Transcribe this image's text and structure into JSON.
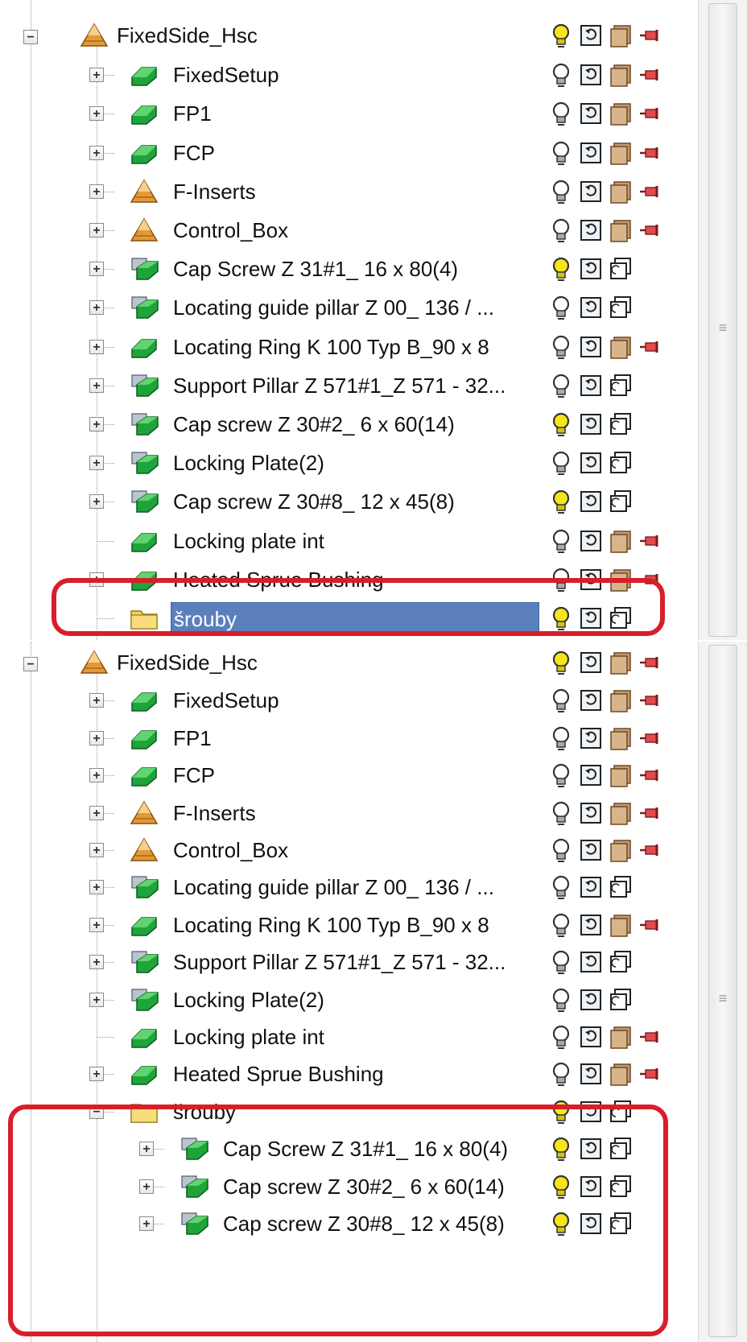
{
  "panels": [
    {
      "id": "before",
      "root": {
        "label": "FixedSide_Hsc",
        "icon": "assembly-icon",
        "expanded": true,
        "bulb": "on"
      },
      "items": [
        {
          "label": "FixedSetup",
          "icon": "part-icon",
          "expander": "+",
          "bulb": "off",
          "controls": [
            "bulb-icon",
            "reset-icon",
            "material-icon",
            "pin-icon"
          ]
        },
        {
          "label": "FP1",
          "icon": "part-icon",
          "expander": "+",
          "bulb": "off",
          "controls": [
            "bulb-icon",
            "reset-icon",
            "material-icon",
            "pin-icon"
          ]
        },
        {
          "label": "FCP",
          "icon": "part-icon",
          "expander": "+",
          "bulb": "off",
          "controls": [
            "bulb-icon",
            "reset-icon",
            "material-icon",
            "pin-icon"
          ]
        },
        {
          "label": "F-Inserts",
          "icon": "assembly-icon",
          "expander": "+",
          "bulb": "off",
          "controls": [
            "bulb-icon",
            "reset-icon",
            "material-icon",
            "pin-icon"
          ]
        },
        {
          "label": "Control_Box",
          "icon": "assembly-icon",
          "expander": "+",
          "bulb": "off",
          "controls": [
            "bulb-icon",
            "reset-icon",
            "material-icon",
            "pin-icon"
          ]
        },
        {
          "label": "Cap Screw Z 31#1_ 16 x 80(4)",
          "icon": "component-icon",
          "expander": "+",
          "bulb": "on",
          "controls": [
            "bulb-icon",
            "reset-icon",
            "view-icon"
          ]
        },
        {
          "label": "Locating guide pillar Z 00_ 136 / ...",
          "icon": "component-icon",
          "expander": "+",
          "bulb": "off",
          "controls": [
            "bulb-icon",
            "reset-icon",
            "view-icon"
          ]
        },
        {
          "label": "Locating Ring K 100 Typ B_90 x 8",
          "icon": "part-icon",
          "expander": "+",
          "bulb": "off",
          "controls": [
            "bulb-icon",
            "reset-icon",
            "material-icon",
            "pin-icon"
          ]
        },
        {
          "label": "Support Pillar Z 571#1_Z 571 - 32...",
          "icon": "component-icon",
          "expander": "+",
          "bulb": "off",
          "controls": [
            "bulb-icon",
            "reset-icon",
            "view-icon"
          ]
        },
        {
          "label": "Cap screw Z 30#2_ 6 x 60(14)",
          "icon": "component-icon",
          "expander": "+",
          "bulb": "on",
          "controls": [
            "bulb-icon",
            "reset-icon",
            "view-icon"
          ]
        },
        {
          "label": "Locking Plate(2)",
          "icon": "component-icon",
          "expander": "+",
          "bulb": "off",
          "controls": [
            "bulb-icon",
            "reset-icon",
            "view-icon"
          ]
        },
        {
          "label": "Cap screw Z 30#8_ 12 x 45(8)",
          "icon": "component-icon",
          "expander": "+",
          "bulb": "on",
          "controls": [
            "bulb-icon",
            "reset-icon",
            "view-icon"
          ]
        },
        {
          "label": "Locking plate int",
          "icon": "part-icon",
          "expander": "",
          "bulb": "off",
          "controls": [
            "bulb-icon",
            "reset-icon",
            "material-icon",
            "pin-icon"
          ]
        },
        {
          "label": "Heated Sprue Bushing",
          "icon": "part-icon",
          "expander": "+",
          "bulb": "off",
          "controls": [
            "bulb-icon",
            "reset-icon",
            "material-icon",
            "pin-icon"
          ]
        },
        {
          "label": "šrouby",
          "icon": "folder-icon",
          "expander": "",
          "bulb": "on",
          "selected": true,
          "controls": [
            "bulb-icon",
            "reset-icon",
            "view-icon"
          ]
        }
      ]
    },
    {
      "id": "after",
      "root": {
        "label": "FixedSide_Hsc",
        "icon": "assembly-icon",
        "expanded": true,
        "bulb": "on"
      },
      "items": [
        {
          "label": "FixedSetup",
          "icon": "part-icon",
          "expander": "+",
          "bulb": "off",
          "controls": [
            "bulb-icon",
            "reset-icon",
            "material-icon",
            "pin-icon"
          ]
        },
        {
          "label": "FP1",
          "icon": "part-icon",
          "expander": "+",
          "bulb": "off",
          "controls": [
            "bulb-icon",
            "reset-icon",
            "material-icon",
            "pin-icon"
          ]
        },
        {
          "label": "FCP",
          "icon": "part-icon",
          "expander": "+",
          "bulb": "off",
          "controls": [
            "bulb-icon",
            "reset-icon",
            "material-icon",
            "pin-icon"
          ]
        },
        {
          "label": "F-Inserts",
          "icon": "assembly-icon",
          "expander": "+",
          "bulb": "off",
          "controls": [
            "bulb-icon",
            "reset-icon",
            "material-icon",
            "pin-icon"
          ]
        },
        {
          "label": "Control_Box",
          "icon": "assembly-icon",
          "expander": "+",
          "bulb": "off",
          "controls": [
            "bulb-icon",
            "reset-icon",
            "material-icon",
            "pin-icon"
          ]
        },
        {
          "label": "Locating guide pillar Z 00_ 136 / ...",
          "icon": "component-icon",
          "expander": "+",
          "bulb": "off",
          "controls": [
            "bulb-icon",
            "reset-icon",
            "view-icon"
          ]
        },
        {
          "label": "Locating Ring K 100 Typ B_90 x 8",
          "icon": "part-icon",
          "expander": "+",
          "bulb": "off",
          "controls": [
            "bulb-icon",
            "reset-icon",
            "material-icon",
            "pin-icon"
          ]
        },
        {
          "label": "Support Pillar Z 571#1_Z 571 - 32...",
          "icon": "component-icon",
          "expander": "+",
          "bulb": "off",
          "controls": [
            "bulb-icon",
            "reset-icon",
            "view-icon"
          ]
        },
        {
          "label": "Locking Plate(2)",
          "icon": "component-icon",
          "expander": "+",
          "bulb": "off",
          "controls": [
            "bulb-icon",
            "reset-icon",
            "view-icon"
          ]
        },
        {
          "label": "Locking plate int",
          "icon": "part-icon",
          "expander": "",
          "bulb": "off",
          "controls": [
            "bulb-icon",
            "reset-icon",
            "material-icon",
            "pin-icon"
          ]
        },
        {
          "label": "Heated Sprue Bushing",
          "icon": "part-icon",
          "expander": "+",
          "bulb": "off",
          "controls": [
            "bulb-icon",
            "reset-icon",
            "material-icon",
            "pin-icon"
          ]
        },
        {
          "label": "šrouby",
          "icon": "folder-icon",
          "expander": "−",
          "bulb": "on",
          "controls": [
            "bulb-icon",
            "reset-icon",
            "view-icon"
          ]
        },
        {
          "label": "Cap Screw Z 31#1_ 16 x 80(4)",
          "icon": "component-icon",
          "expander": "+",
          "bulb": "on",
          "child": true,
          "controls": [
            "bulb-icon",
            "reset-icon",
            "view-icon"
          ]
        },
        {
          "label": "Cap screw Z 30#2_ 6 x 60(14)",
          "icon": "component-icon",
          "expander": "+",
          "bulb": "on",
          "child": true,
          "controls": [
            "bulb-icon",
            "reset-icon",
            "view-icon"
          ]
        },
        {
          "label": "Cap screw Z 30#8_ 12 x 45(8)",
          "icon": "component-icon",
          "expander": "+",
          "bulb": "on",
          "child": true,
          "controls": [
            "bulb-icon",
            "reset-icon",
            "view-icon"
          ]
        }
      ]
    }
  ],
  "colors": {
    "highlight": "#d81e2a",
    "selection": "#5b7fbd",
    "bulb_on": "#f5e51a",
    "bulb_off": "#7a7a7a",
    "part_green": "#1ea43a",
    "assembly_orange": "#e39a36"
  }
}
